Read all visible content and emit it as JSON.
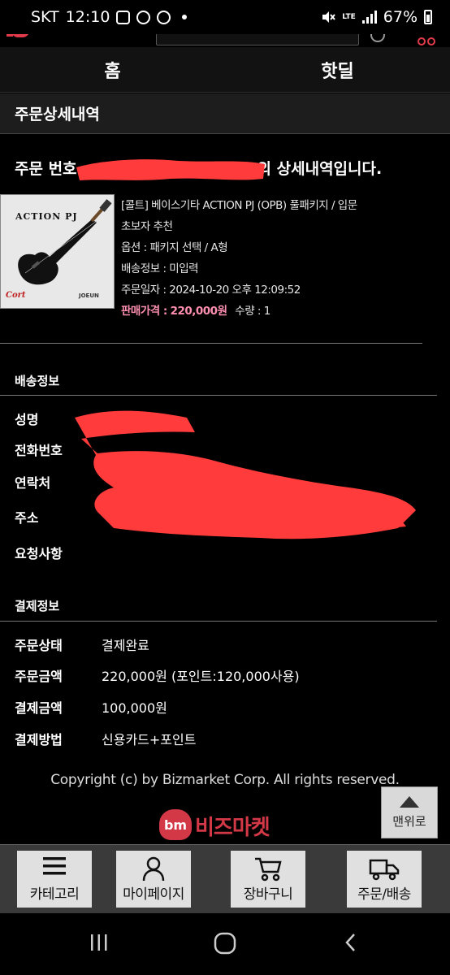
{
  "status_bar": {
    "carrier": "SKT",
    "time": "12:10",
    "network": "LTE",
    "battery": "67%",
    "icons": [
      "gallery-icon",
      "messenger-icon",
      "chat-icon",
      "notification-dot",
      "mute-icon",
      "signal-icon",
      "battery-icon"
    ]
  },
  "nav": {
    "tabs": [
      {
        "label": "홈"
      },
      {
        "label": "핫딜"
      }
    ]
  },
  "page": {
    "title": "주문상세내역",
    "order_heading_prefix": "주문 번호",
    "order_heading_suffix": "의 상세내역입니다."
  },
  "product": {
    "thumb_title": "ACTION PJ",
    "thumb_brand": "Cort",
    "thumb_maker": "JOEUN",
    "name_line1": "[콜트] 베이스기타 ACTION PJ (OPB) 풀패키지 / 입문",
    "name_line2": "초보자 추천",
    "option": "옵션 : 패키지 선택 / A형",
    "shipping": "배송정보 : 미입력",
    "order_date": "주문일자 : 2024-10-20 오후 12:09:52",
    "price_label": "판매가격 :",
    "price_value": "220,000원",
    "quantity": "수량 : 1"
  },
  "delivery": {
    "title": "배송정보",
    "labels": [
      "성명",
      "전화번호",
      "연락처",
      "주소",
      "요청사항"
    ]
  },
  "payment": {
    "title": "결제정보",
    "rows": [
      {
        "label": "주문상태",
        "value": "결제완료"
      },
      {
        "label": "주문금액",
        "value": "220,000원 (포인트:120,000사용)"
      },
      {
        "label": "결제금액",
        "value": "100,000원"
      },
      {
        "label": "결제방법",
        "value": "신용카드+포인트"
      }
    ]
  },
  "footer": {
    "copyright": "Copyright (c) by Bizmarket Corp. All rights reserved.",
    "logo_mark": "bm",
    "logo_name": "비즈마켓",
    "top_button": "맨위로"
  },
  "bottom_bar": {
    "items": [
      {
        "label": "카테고리",
        "icon": "menu-icon"
      },
      {
        "label": "마이페이지",
        "icon": "person-icon"
      },
      {
        "label": "장바구니",
        "icon": "cart-icon"
      },
      {
        "label": "주문/배송",
        "icon": "truck-icon"
      }
    ]
  },
  "colors": {
    "brand": "#d23846",
    "price": "#ff8fb0",
    "redaction": "#ff3b3b"
  }
}
